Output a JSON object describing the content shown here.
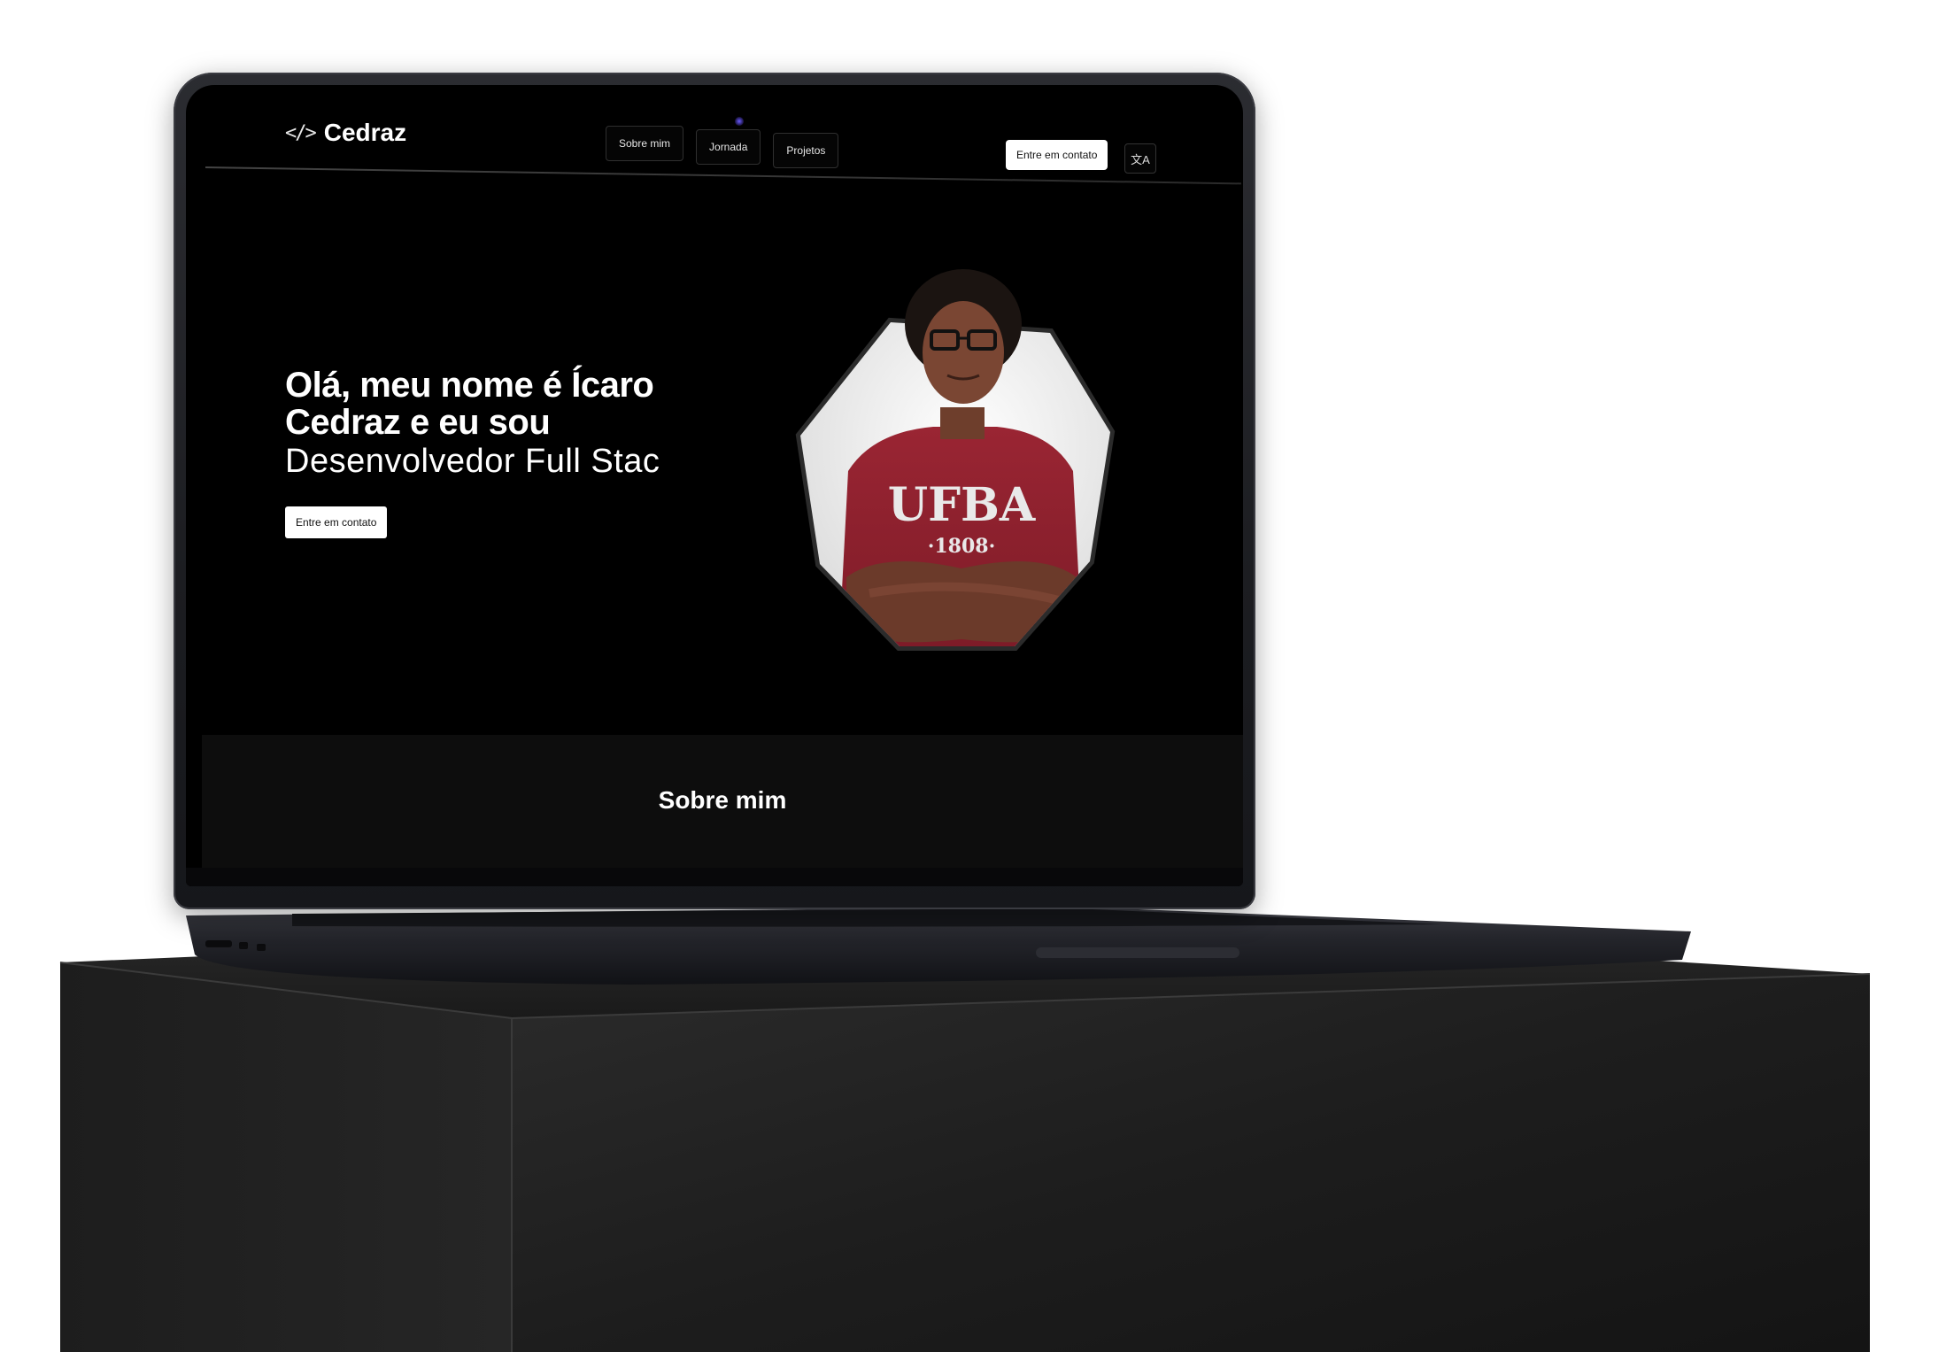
{
  "site": {
    "brand": {
      "icon": "code-brackets-icon",
      "icon_glyph": "</>",
      "name": "Cedraz"
    },
    "nav": {
      "tabs": [
        {
          "label": "Sobre mim"
        },
        {
          "label": "Jornada"
        },
        {
          "label": "Projetos"
        }
      ],
      "contact_label": "Entre em contato",
      "translate_icon": "translate-icon",
      "translate_glyph": "文A"
    },
    "hero": {
      "title_line1": "Olá, meu nome é Ícaro",
      "title_line2": "Cedraz e eu sou",
      "subtitle": "Desenvolvedor Full Stac",
      "button_label": "Entre em contato",
      "portrait_shirt_text": "UFBA",
      "portrait_shirt_year": "·1808·"
    },
    "about": {
      "title": "Sobre mim"
    }
  },
  "colors": {
    "page_background": "#ffffff",
    "screen_background": "#000000",
    "accent_button": "#ffffff",
    "shirt": "#8e1f2c",
    "pedestal": "#1a1a1a"
  }
}
